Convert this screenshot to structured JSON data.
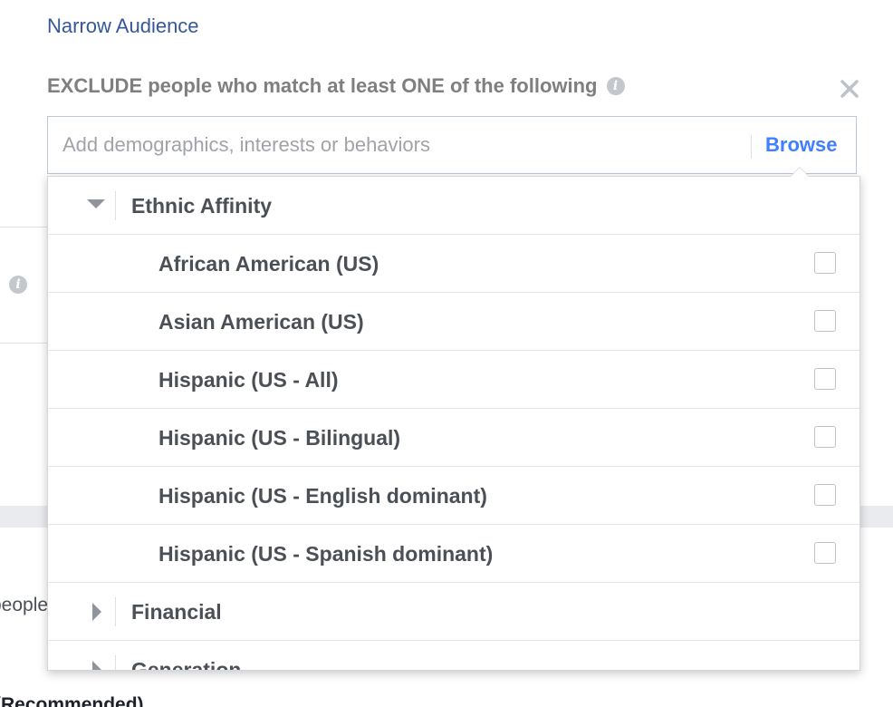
{
  "narrow_audience": {
    "label": "Narrow Audience"
  },
  "exclude": {
    "heading": "EXCLUDE people who match at least ONE of the following",
    "info_icon": "info-icon",
    "close_icon": "close-icon"
  },
  "search": {
    "placeholder": "Add demographics, interests or behaviors",
    "value": "",
    "browse_label": "Browse"
  },
  "background": {
    "info_icon": "info-icon",
    "people_text": "people",
    "recommended_text": "(Recommended)"
  },
  "dropdown": {
    "category_expanded": {
      "label": "Ethnic Affinity",
      "state": "expanded",
      "icon": "triangle-down-icon"
    },
    "options": [
      {
        "label": "African American (US)",
        "checked": false
      },
      {
        "label": "Asian American (US)",
        "checked": false
      },
      {
        "label": "Hispanic (US - All)",
        "checked": false
      },
      {
        "label": "Hispanic (US - Bilingual)",
        "checked": false
      },
      {
        "label": "Hispanic (US - English dominant)",
        "checked": false
      },
      {
        "label": "Hispanic (US - Spanish dominant)",
        "checked": false
      }
    ],
    "collapsed_categories": [
      {
        "label": "Financial",
        "state": "collapsed",
        "icon": "triangle-right-icon"
      },
      {
        "label": "Generation",
        "state": "collapsed",
        "icon": "triangle-right-icon"
      }
    ]
  },
  "colors": {
    "link": "#365899",
    "browse": "#4080ff",
    "heading_gray": "#7f7f7f",
    "item_text": "#4b4f56",
    "border": "#bdc7d8"
  }
}
